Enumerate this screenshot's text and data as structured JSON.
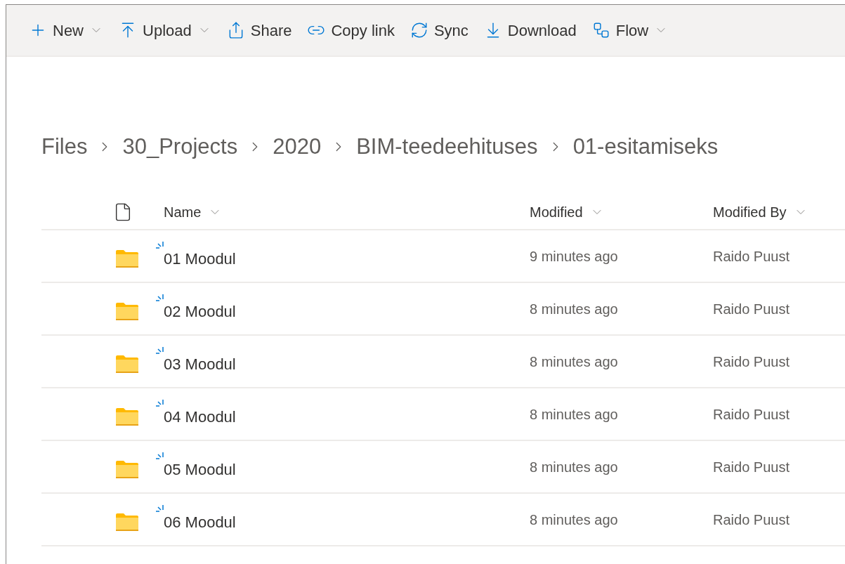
{
  "command_bar": [
    {
      "label": "New",
      "dropdown": true
    },
    {
      "label": "Upload",
      "dropdown": true
    },
    {
      "label": "Share",
      "dropdown": false
    },
    {
      "label": "Copy link",
      "dropdown": false
    },
    {
      "label": "Sync",
      "dropdown": false
    },
    {
      "label": "Download",
      "dropdown": false
    },
    {
      "label": "Flow",
      "dropdown": true
    }
  ],
  "breadcrumb": [
    "Files",
    "30_Projects",
    "2020",
    "BIM-teedeehituses",
    "01-esitamiseks"
  ],
  "table": {
    "columns": [
      "Name",
      "Modified",
      "Modified By"
    ],
    "rows": [
      {
        "name": "01 Moodul",
        "modified": "9 minutes ago",
        "modified_by": "Raido Puust"
      },
      {
        "name": "02 Moodul",
        "modified": "8 minutes ago",
        "modified_by": "Raido Puust"
      },
      {
        "name": "03 Moodul",
        "modified": "8 minutes ago",
        "modified_by": "Raido Puust"
      },
      {
        "name": "04 Moodul",
        "modified": "8 minutes ago",
        "modified_by": "Raido Puust"
      },
      {
        "name": "05 Moodul",
        "modified": "8 minutes ago",
        "modified_by": "Raido Puust"
      },
      {
        "name": "06 Moodul",
        "modified": "8 minutes ago",
        "modified_by": "Raido Puust"
      }
    ]
  }
}
